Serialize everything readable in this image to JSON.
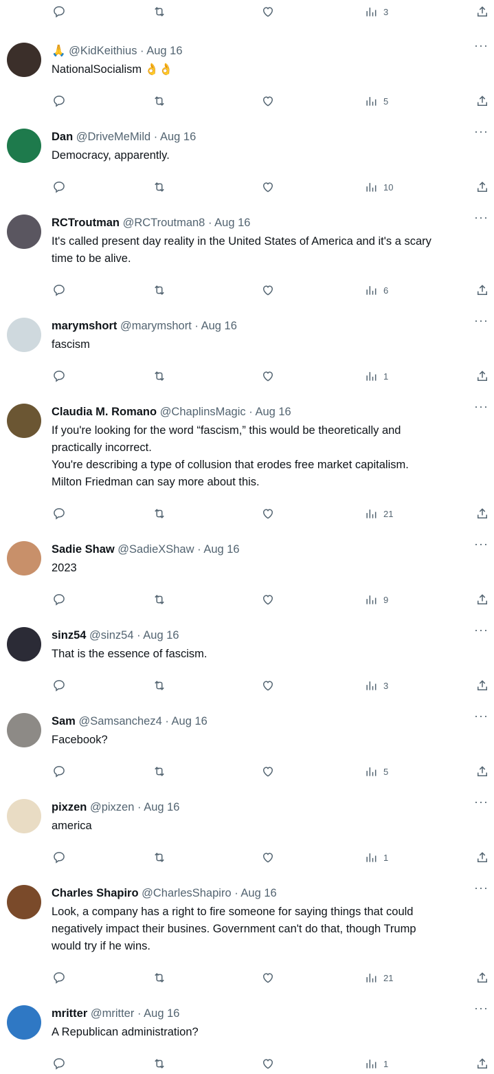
{
  "top_actions": {
    "views": "3"
  },
  "tweets": [
    {
      "name": "",
      "handle": "@KidKeithius",
      "date": "Aug 16",
      "lines": [
        "NationalSocialism 👌👌"
      ],
      "views": "5",
      "avatar_color": "#3b2f2a"
    },
    {
      "name": "Dan",
      "handle": "@DriveMeMild",
      "date": "Aug 16",
      "lines": [
        "Democracy, apparently."
      ],
      "views": "10",
      "avatar_color": "#1e7a4c"
    },
    {
      "name": "RCTroutman",
      "handle": "@RCTroutman8",
      "date": "Aug 16",
      "lines": [
        "It's called present day reality in the United States of America and it's a scary",
        "time to be alive."
      ],
      "views": "6",
      "avatar_color": "#5a5660"
    },
    {
      "name": "marymshort",
      "handle": "@marymshort",
      "date": "Aug 16",
      "lines": [
        "fascism"
      ],
      "views": "1",
      "avatar_color": "#cfd9de"
    },
    {
      "name": "Claudia M. Romano",
      "handle": "@ChaplinsMagic",
      "date": "Aug 16",
      "lines": [
        "If you're looking for the word “fascism,” this would be theoretically and",
        "practically incorrect.",
        "You're describing a type of collusion that erodes free market capitalism.",
        "Milton Friedman can say more about this."
      ],
      "views": "21",
      "avatar_color": "#6b5633"
    },
    {
      "name": "Sadie Shaw",
      "handle": "@SadieXShaw",
      "date": "Aug 16",
      "lines": [
        "2023"
      ],
      "views": "9",
      "avatar_color": "#c8906a"
    },
    {
      "name": "sinz54",
      "handle": "@sinz54",
      "date": "Aug 16",
      "lines": [
        "That is the essence of fascism."
      ],
      "views": "3",
      "avatar_color": "#2b2b36"
    },
    {
      "name": "Sam",
      "handle": "@Samsanchez4",
      "date": "Aug 16",
      "lines": [
        "Facebook?"
      ],
      "views": "5",
      "avatar_color": "#8d8a86"
    },
    {
      "name": "pixzen",
      "handle": "@pixzen",
      "date": "Aug 16",
      "lines": [
        "america"
      ],
      "views": "1",
      "avatar_color": "#e9dcc4"
    },
    {
      "name": "Charles Shapiro",
      "handle": "@CharlesShapiro",
      "date": "Aug 16",
      "lines": [
        "Look, a company has a right to fire someone for saying things that could",
        "negatively impact their busines.  Government can't do that, though Trump",
        "would try if he wins."
      ],
      "views": "21",
      "avatar_color": "#7a4a2a"
    },
    {
      "name": "mritter",
      "handle": "@mritter",
      "date": "Aug 16",
      "lines": [
        "A Republican administration?"
      ],
      "views": "1",
      "avatar_color": "#2f78c4"
    }
  ],
  "ui": {
    "more_label": "···",
    "dot": "·"
  },
  "icons": {
    "reply": "reply-icon",
    "retweet": "retweet-icon",
    "like": "heart-icon",
    "views": "views-icon",
    "share": "share-icon"
  }
}
